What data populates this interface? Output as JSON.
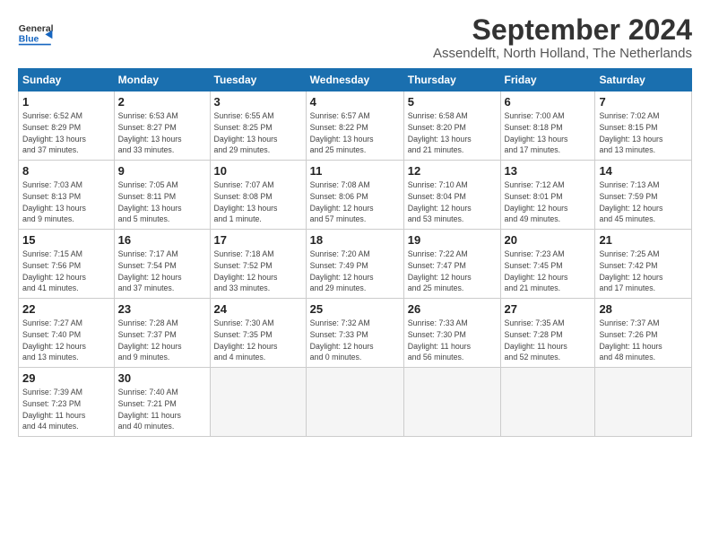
{
  "header": {
    "logo_general": "General",
    "logo_blue": "Blue",
    "title": "September 2024",
    "subtitle": "Assendelft, North Holland, The Netherlands"
  },
  "weekdays": [
    "Sunday",
    "Monday",
    "Tuesday",
    "Wednesday",
    "Thursday",
    "Friday",
    "Saturday"
  ],
  "weeks": [
    [
      {
        "num": "1",
        "info": "Sunrise: 6:52 AM\nSunset: 8:29 PM\nDaylight: 13 hours\nand 37 minutes."
      },
      {
        "num": "2",
        "info": "Sunrise: 6:53 AM\nSunset: 8:27 PM\nDaylight: 13 hours\nand 33 minutes."
      },
      {
        "num": "3",
        "info": "Sunrise: 6:55 AM\nSunset: 8:25 PM\nDaylight: 13 hours\nand 29 minutes."
      },
      {
        "num": "4",
        "info": "Sunrise: 6:57 AM\nSunset: 8:22 PM\nDaylight: 13 hours\nand 25 minutes."
      },
      {
        "num": "5",
        "info": "Sunrise: 6:58 AM\nSunset: 8:20 PM\nDaylight: 13 hours\nand 21 minutes."
      },
      {
        "num": "6",
        "info": "Sunrise: 7:00 AM\nSunset: 8:18 PM\nDaylight: 13 hours\nand 17 minutes."
      },
      {
        "num": "7",
        "info": "Sunrise: 7:02 AM\nSunset: 8:15 PM\nDaylight: 13 hours\nand 13 minutes."
      }
    ],
    [
      {
        "num": "8",
        "info": "Sunrise: 7:03 AM\nSunset: 8:13 PM\nDaylight: 13 hours\nand 9 minutes."
      },
      {
        "num": "9",
        "info": "Sunrise: 7:05 AM\nSunset: 8:11 PM\nDaylight: 13 hours\nand 5 minutes."
      },
      {
        "num": "10",
        "info": "Sunrise: 7:07 AM\nSunset: 8:08 PM\nDaylight: 13 hours\nand 1 minute."
      },
      {
        "num": "11",
        "info": "Sunrise: 7:08 AM\nSunset: 8:06 PM\nDaylight: 12 hours\nand 57 minutes."
      },
      {
        "num": "12",
        "info": "Sunrise: 7:10 AM\nSunset: 8:04 PM\nDaylight: 12 hours\nand 53 minutes."
      },
      {
        "num": "13",
        "info": "Sunrise: 7:12 AM\nSunset: 8:01 PM\nDaylight: 12 hours\nand 49 minutes."
      },
      {
        "num": "14",
        "info": "Sunrise: 7:13 AM\nSunset: 7:59 PM\nDaylight: 12 hours\nand 45 minutes."
      }
    ],
    [
      {
        "num": "15",
        "info": "Sunrise: 7:15 AM\nSunset: 7:56 PM\nDaylight: 12 hours\nand 41 minutes."
      },
      {
        "num": "16",
        "info": "Sunrise: 7:17 AM\nSunset: 7:54 PM\nDaylight: 12 hours\nand 37 minutes."
      },
      {
        "num": "17",
        "info": "Sunrise: 7:18 AM\nSunset: 7:52 PM\nDaylight: 12 hours\nand 33 minutes."
      },
      {
        "num": "18",
        "info": "Sunrise: 7:20 AM\nSunset: 7:49 PM\nDaylight: 12 hours\nand 29 minutes."
      },
      {
        "num": "19",
        "info": "Sunrise: 7:22 AM\nSunset: 7:47 PM\nDaylight: 12 hours\nand 25 minutes."
      },
      {
        "num": "20",
        "info": "Sunrise: 7:23 AM\nSunset: 7:45 PM\nDaylight: 12 hours\nand 21 minutes."
      },
      {
        "num": "21",
        "info": "Sunrise: 7:25 AM\nSunset: 7:42 PM\nDaylight: 12 hours\nand 17 minutes."
      }
    ],
    [
      {
        "num": "22",
        "info": "Sunrise: 7:27 AM\nSunset: 7:40 PM\nDaylight: 12 hours\nand 13 minutes."
      },
      {
        "num": "23",
        "info": "Sunrise: 7:28 AM\nSunset: 7:37 PM\nDaylight: 12 hours\nand 9 minutes."
      },
      {
        "num": "24",
        "info": "Sunrise: 7:30 AM\nSunset: 7:35 PM\nDaylight: 12 hours\nand 4 minutes."
      },
      {
        "num": "25",
        "info": "Sunrise: 7:32 AM\nSunset: 7:33 PM\nDaylight: 12 hours\nand 0 minutes."
      },
      {
        "num": "26",
        "info": "Sunrise: 7:33 AM\nSunset: 7:30 PM\nDaylight: 11 hours\nand 56 minutes."
      },
      {
        "num": "27",
        "info": "Sunrise: 7:35 AM\nSunset: 7:28 PM\nDaylight: 11 hours\nand 52 minutes."
      },
      {
        "num": "28",
        "info": "Sunrise: 7:37 AM\nSunset: 7:26 PM\nDaylight: 11 hours\nand 48 minutes."
      }
    ],
    [
      {
        "num": "29",
        "info": "Sunrise: 7:39 AM\nSunset: 7:23 PM\nDaylight: 11 hours\nand 44 minutes."
      },
      {
        "num": "30",
        "info": "Sunrise: 7:40 AM\nSunset: 7:21 PM\nDaylight: 11 hours\nand 40 minutes."
      },
      {
        "num": "",
        "info": ""
      },
      {
        "num": "",
        "info": ""
      },
      {
        "num": "",
        "info": ""
      },
      {
        "num": "",
        "info": ""
      },
      {
        "num": "",
        "info": ""
      }
    ]
  ]
}
